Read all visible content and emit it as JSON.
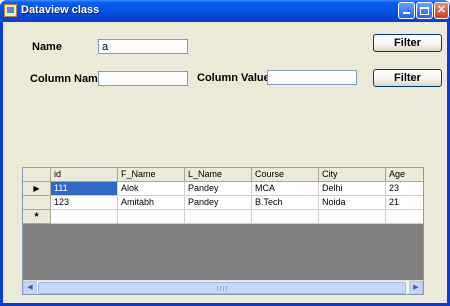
{
  "window": {
    "title": "Dataview class",
    "minimize": "minimize",
    "maximize": "maximize",
    "close": "✕"
  },
  "form": {
    "name_label": "Name",
    "name_value": "a",
    "filter_button_1": "Filter",
    "column_name_label": "Column Name",
    "column_name_value": "",
    "column_value_label": "Column Value",
    "column_value_value": "",
    "filter_button_2": "Filter"
  },
  "grid": {
    "columns": [
      "id",
      "F_Name",
      "L_Name",
      "Course",
      "City",
      "Age"
    ],
    "rows": [
      [
        "111",
        "Alok",
        "Pandey",
        "MCA",
        "Delhi",
        "23"
      ],
      [
        "123",
        "Amitabh",
        "Pandey",
        "B.Tech",
        "Noida",
        "21"
      ]
    ],
    "current_row_marker": "▶",
    "new_row_marker": "*",
    "selected_cell": {
      "row": 0,
      "column": "id"
    }
  },
  "icons": {
    "app": "app-icon",
    "scroll_left": "◀",
    "scroll_right": "▶"
  }
}
